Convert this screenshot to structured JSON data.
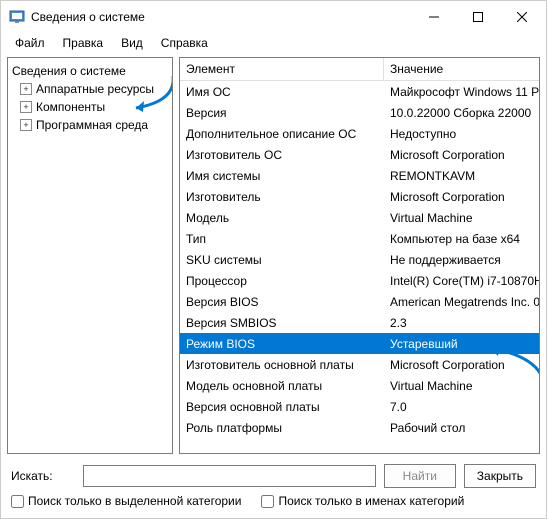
{
  "window": {
    "title": "Сведения о системе"
  },
  "menu": {
    "file": "Файл",
    "edit": "Правка",
    "view": "Вид",
    "help": "Справка"
  },
  "tree": {
    "root": "Сведения о системе",
    "items": [
      "Аппаратные ресурсы",
      "Компоненты",
      "Программная среда"
    ]
  },
  "list": {
    "header_key": "Элемент",
    "header_val": "Значение",
    "rows": [
      {
        "k": "Имя ОС",
        "v": "Майкрософт Windows 11 P"
      },
      {
        "k": "Версия",
        "v": "10.0.22000 Сборка 22000"
      },
      {
        "k": "Дополнительное описание ОС",
        "v": "Недоступно"
      },
      {
        "k": "Изготовитель ОС",
        "v": "Microsoft Corporation"
      },
      {
        "k": "Имя системы",
        "v": "REMONTKAVM"
      },
      {
        "k": "Изготовитель",
        "v": "Microsoft Corporation"
      },
      {
        "k": "Модель",
        "v": "Virtual Machine"
      },
      {
        "k": "Тип",
        "v": "Компьютер на базе x64"
      },
      {
        "k": "SKU системы",
        "v": "Не поддерживается"
      },
      {
        "k": "Процессор",
        "v": "Intel(R) Core(TM) i7-10870H"
      },
      {
        "k": "Версия BIOS",
        "v": "American Megatrends Inc. 0"
      },
      {
        "k": "Версия SMBIOS",
        "v": "2.3"
      },
      {
        "k": "Режим BIOS",
        "v": "Устаревший"
      },
      {
        "k": "Изготовитель основной платы",
        "v": "Microsoft Corporation"
      },
      {
        "k": "Модель основной платы",
        "v": "Virtual Machine"
      },
      {
        "k": "Версия основной платы",
        "v": "7.0"
      },
      {
        "k": "Роль платформы",
        "v": "Рабочий стол"
      }
    ],
    "selected_index": 12
  },
  "footer": {
    "search_label": "Искать:",
    "search_value": "",
    "find_btn": "Найти",
    "close_btn": "Закрыть",
    "cb_selected": "Поиск только в выделенной категории",
    "cb_names": "Поиск только в именах категорий"
  }
}
